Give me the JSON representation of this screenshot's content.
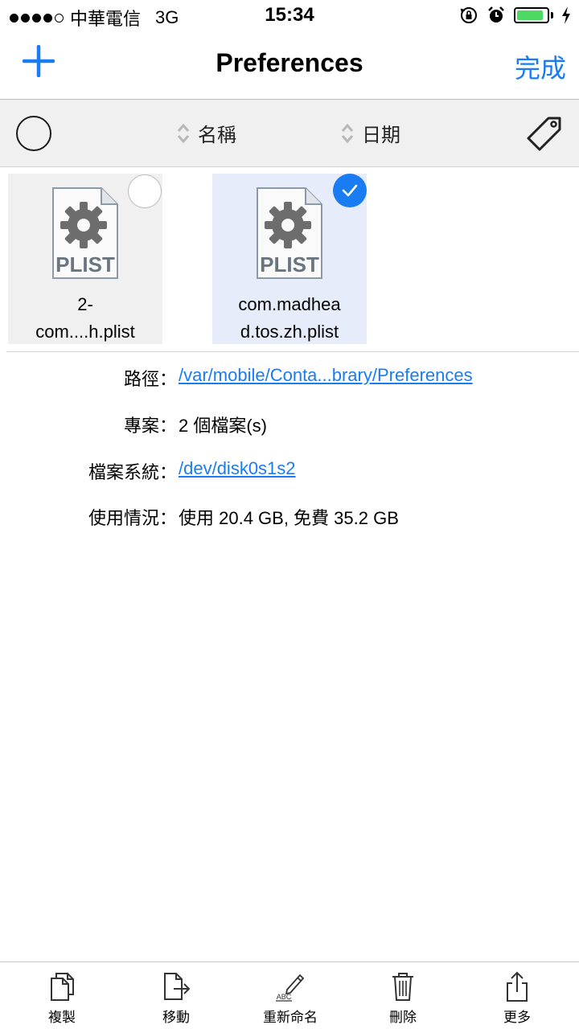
{
  "status_bar": {
    "carrier": "中華電信",
    "network": "3G",
    "time": "15:34"
  },
  "nav": {
    "title": "Preferences",
    "done_label": "完成"
  },
  "sort_bar": {
    "name_label": "名稱",
    "date_label": "日期"
  },
  "files": [
    {
      "name_line1": "2-",
      "name_line2": "com....h.plist",
      "badge": "PLIST",
      "selected": false
    },
    {
      "name_line1": "com.madhea",
      "name_line2": "d.tos.zh.plist",
      "badge": "PLIST",
      "selected": true
    }
  ],
  "info": {
    "path_label": "路徑：",
    "path_value": "/var/mobile/Conta...brary/Preferences",
    "items_label": "專案：",
    "items_value": "2 個檔案(s)",
    "fs_label": "檔案系統：",
    "fs_value": "/dev/disk0s1s2",
    "usage_label": "使用情況：",
    "usage_value": "使用 20.4 GB, 免費 35.2 GB"
  },
  "toolbar": {
    "copy_label": "複製",
    "move_label": "移動",
    "rename_label": "重新命名",
    "rename_icon_text": "ABC",
    "delete_label": "刪除",
    "more_label": "更多"
  },
  "colors": {
    "accent": "#1a7cf2",
    "battery": "#4cd964"
  }
}
